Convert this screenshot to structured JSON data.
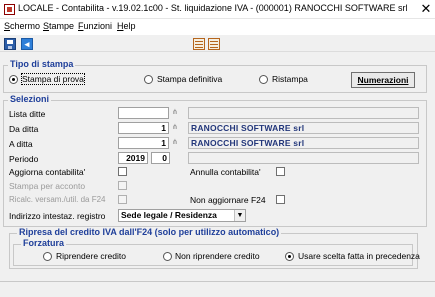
{
  "window": {
    "title": "LOCALE - Contabilita - v.19.02.1c00 - St. liquidazione IVA  -  (000001) RANOCCHI SOFTWARE srl",
    "close_glyph": "✕"
  },
  "menu": [
    {
      "label": "Schermo",
      "underline": "S",
      "rest": "chermo"
    },
    {
      "label": "Stampe",
      "underline": "S",
      "rest": "tampe"
    },
    {
      "label": "Funzioni",
      "underline": "F",
      "rest": "unzioni"
    },
    {
      "label": "Help",
      "underline": "H",
      "rest": "elp"
    }
  ],
  "toolbar": {
    "icons": [
      "save-icon",
      "back-arrow-icon",
      "print-preview-icon",
      "print-icon"
    ],
    "back_glyph": "◂"
  },
  "tipo_stampa": {
    "legend": "Tipo di stampa",
    "options": [
      {
        "label": "Stampa di prova",
        "selected": true
      },
      {
        "label": "Stampa definitiva",
        "selected": false
      },
      {
        "label": "Ristampa",
        "selected": false
      }
    ],
    "numerazioni_label": "Numerazioni"
  },
  "selezioni": {
    "legend": "Selezioni",
    "lookup_glyph": "⋔",
    "lista_ditte": {
      "label": "Lista ditte",
      "value": "",
      "desc": ""
    },
    "da_ditta": {
      "label": "Da ditta",
      "value": "1",
      "desc": "RANOCCHI SOFTWARE srl"
    },
    "a_ditta": {
      "label": "A ditta",
      "value": "1",
      "desc": "RANOCCHI SOFTWARE srl"
    },
    "periodo": {
      "label": "Periodo",
      "year": "2019",
      "month": "0",
      "desc": ""
    },
    "aggiorna_contabilita": {
      "label": "Aggiorna contabilita'",
      "checked": false
    },
    "annulla_contabilita": {
      "label": "Annulla contabilita'",
      "checked": false
    },
    "stampa_per_acconto": {
      "label": "Stampa per acconto",
      "checked": false
    },
    "ricalc_versam": {
      "label": "Ricalc. versam./util. da F24",
      "checked": false
    },
    "non_aggiornare_f24": {
      "label": "Non aggiornare F24",
      "checked": false
    },
    "indirizzo": {
      "label": "Indirizzo intestaz. registro",
      "value": "Sede legale / Residenza",
      "arrow": "▼"
    }
  },
  "ripresa": {
    "legend": "Ripresa del credito IVA dall'F24 (solo per utilizzo automatico)",
    "forzatura_legend": "Forzatura",
    "options": [
      {
        "label": "Riprendere credito",
        "selected": false
      },
      {
        "label": "Non riprendere credito",
        "selected": false
      },
      {
        "label": "Usare scelta fatta in precedenza",
        "selected": true
      }
    ]
  }
}
